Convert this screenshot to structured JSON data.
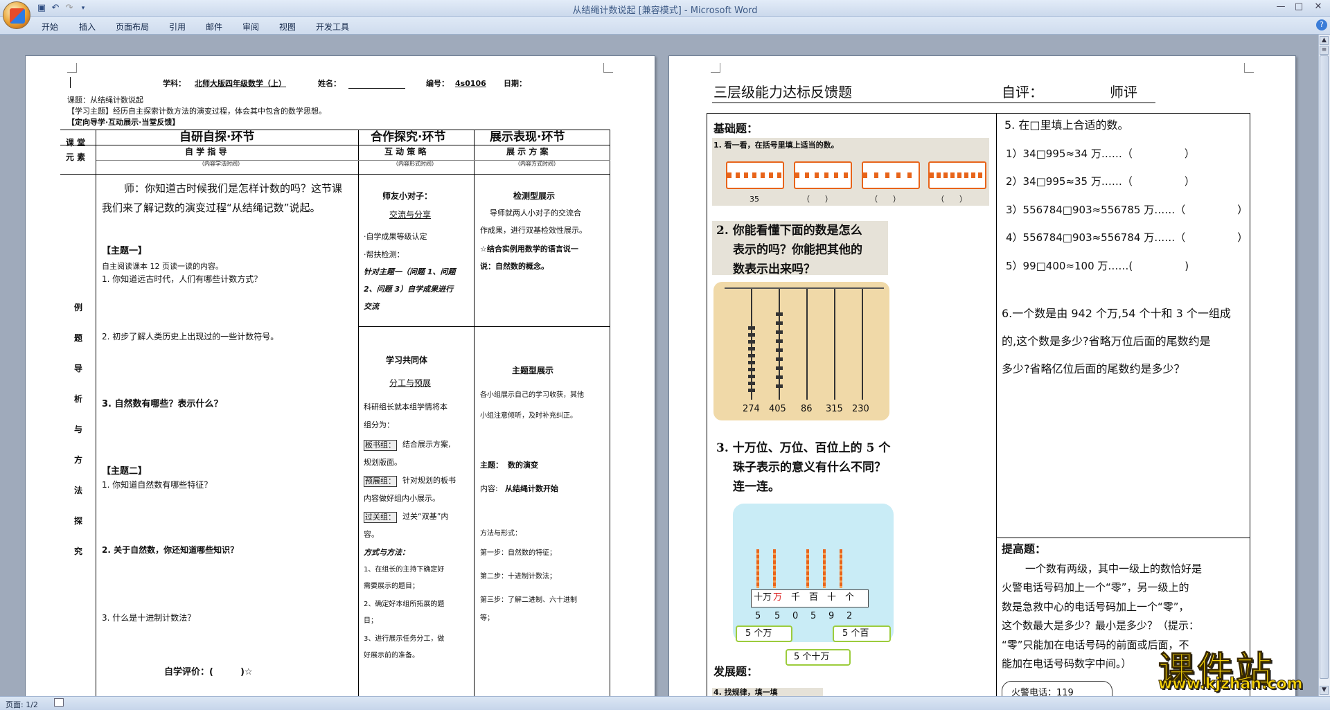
{
  "window": {
    "title": "从结绳计数说起 [兼容模式] - Microsoft Word",
    "controls": [
      "—",
      "□",
      "✕"
    ]
  },
  "ribbon": {
    "tabs": [
      "开始",
      "插入",
      "页面布局",
      "引用",
      "邮件",
      "审阅",
      "视图",
      "开发工具"
    ]
  },
  "status": {
    "page": "页面: 1/2"
  },
  "page1": {
    "header": {
      "subject_label": "学科：",
      "subject_value": "北师大版四年级数学（上）",
      "name_label": "姓名：",
      "code_label": "编号：",
      "code_value": "4s0106",
      "date_label": "日期："
    },
    "lesson": "课题：从结绳计数说起",
    "theme": "【学习主题】经历自主探索计数方法的演变过程，体会其中包含的数学思想。",
    "guide": "【定向导学·互动展示·当堂反馈】",
    "table": {
      "col0_head1": "课 堂",
      "col0_head2": "元 素",
      "col1_head": "自研自探·环节",
      "col1_sub": "自 学 指 导",
      "col1_note": "（内容学法时间）",
      "col2_head": "合作探究·环节",
      "col2_sub": "互 动 策 略",
      "col2_note": "（内容形式时间）",
      "col3_head": "展示表现·环节",
      "col3_sub": "展 示 方 案",
      "col3_note": "（内容方式时间）",
      "side_chars": [
        "例",
        "题",
        "导",
        "析",
        "与",
        "方",
        "法",
        "探",
        "究"
      ]
    },
    "col1": {
      "intro1": "师：你知道古时候我们是怎样计数的吗？这节课",
      "intro2": "我们来了解记数的演变过程“从结绳记数”说起。",
      "topic1": "【主题一】",
      "read": "自主阅读课本 12 页读一读的内容。",
      "q1": "1. 你知道远古时代，人们有哪些计数方式？",
      "q2": "2. 初步了解人类历史上出现过的一些计数符号。",
      "q3": "3. 自然数有哪些？表示什么？",
      "topic2": "【主题二】",
      "q4": "1. 你知道自然数有哪些特征？",
      "q5": "2. 关于自然数，你还知道哪些知识？",
      "q6": "3. 什么是十进制计数法？",
      "eval": "自学评价：(　　　)☆"
    },
    "col2": {
      "pair": "师友小对子：",
      "exchange": "交流与分享",
      "rank": "·自学成果等级认定",
      "help": "·帮扶检测：",
      "target1": "针对主题一（问题 1、问题",
      "target2": "2、问题 3）自学成果进行",
      "target3": "交流",
      "community": "学习共同体",
      "division": "分工与预展",
      "leader1": "科研组长就本组学情将本",
      "leader2": "组分为：",
      "board": "板书组：",
      "board_t1": "结合展示方案,",
      "board_t2": "规划版面。",
      "preview": "预展组：",
      "preview_t1": "针对规划的板书",
      "preview_t2": "内容做好组内小展示。",
      "pass": "过关组：",
      "pass_t1": "过关“双基”内",
      "pass_t2": "容。",
      "method": "方式与方法：",
      "m1a": "1、在组长的主持下确定好",
      "m1b": "需要展示的题目；",
      "m2a": "2、确定好本组所拓展的题",
      "m2b": "目；",
      "m3a": "3、进行展示任务分工，做",
      "m3b": "好展示前的准备。"
    },
    "col3": {
      "check": "检测型展示",
      "check1": "导师就两人小对子的交流合",
      "check2": "作成果，进行双基检效性展示。",
      "combo1": "☆结合实例用数学的语言说一",
      "combo2": "说：自然数的概念。",
      "topic": "主题型展示",
      "show1": "各小组展示自己的学习收获，其他",
      "show2": "小组注意倾听，及时补充纠正。",
      "theme_label": "主题：",
      "theme_value": "数的演变",
      "content_label": "内容:",
      "content_value": "从结绳计数开始",
      "form": "方法与形式：",
      "step1": "第一步：自然数的特征；",
      "step2": "第二步：十进制计数法；",
      "step3a": "第三步：了解二进制、六十进制",
      "step3b": "等；"
    }
  },
  "page2": {
    "title": "三层级能力达标反馈题",
    "self_eval": "自评：",
    "teacher_eval": "师评",
    "basic": "基础题：",
    "b1": "1. 看一看，在括号里填上适当的数。",
    "abacus_labels": [
      "35",
      "（　　）",
      "（　　）",
      "（　　）"
    ],
    "b2_1": "2. 你能看懂下面的数是怎么",
    "b2_2": "表示的吗？你能把其他的",
    "b2_3": "数表示出来吗？",
    "rod_numbers": [
      "274",
      "405",
      "86",
      "315",
      "230"
    ],
    "b3_1": "3. 十万位、万位、百位上的 5 个",
    "b3_2": "珠子表示的意义有什么不同？",
    "b3_3": "连一连。",
    "place_labels": [
      "十万",
      "万",
      "千",
      "百",
      "十",
      "个"
    ],
    "place_digits": [
      "5",
      "5",
      "0",
      "5",
      "9",
      "2"
    ],
    "choices": [
      "5 个万",
      "5 个百",
      "5 个十万"
    ],
    "develop": "发展题：",
    "develop_sub": "4. 找规律，填一填",
    "q5": "5. 在□里填上合适的数。",
    "q5_items": [
      "1）34□995≈34 万……（　　　　　）",
      "2）34□995≈35 万……（　　　　　）",
      "3）556784□903≈556785 万……（　　　　　）",
      "4）556784□903≈556784 万……（　　　　　）",
      "5）99□400≈100 万……(　　　　　)"
    ],
    "q6_1": "6.一个数是由 942 个万,54 个十和 3 个一组成",
    "q6_2": "的,这个数是多少?省略万位后面的尾数约是",
    "q6_3": "多少?省略亿位后面的尾数约是多少？",
    "improve": "提高题：",
    "improve_lines": [
      "一个数有两级，其中一级上的数恰好是",
      "火警电话号码加上一个“零”，另一级上的",
      "数是急救中心的电话号码加上一个“零”，",
      "这个数最大是多少？最小是多少？（提示：",
      "“零”只能加在电话号码的前面或后面，不",
      "能加在电话号码数字中间。）"
    ],
    "fire": "火警电话：119"
  },
  "watermark": {
    "main": "课件站",
    "url": "www.kjzhan.com"
  },
  "colors": {
    "accent": "#2b5797",
    "abacus_orange": "#e8641a",
    "watermark_yellow": "#f7d40a"
  }
}
